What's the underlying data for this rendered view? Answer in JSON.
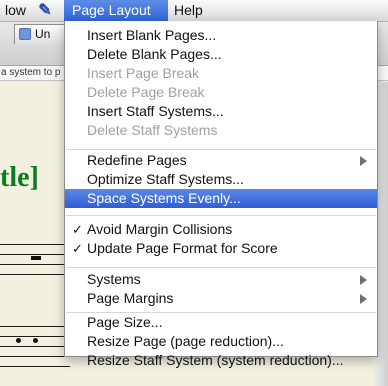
{
  "menubar": {
    "menus": [
      {
        "label": "low"
      },
      {
        "icon": "script-icon"
      },
      {
        "label": "Page Layout"
      },
      {
        "label": "Help"
      }
    ]
  },
  "background": {
    "document_tab": "Un",
    "hint_text": "a system to p",
    "page_title_fragment": "tle]"
  },
  "menu": {
    "items": [
      {
        "label": "Insert Blank Pages..."
      },
      {
        "label": "Delete Blank Pages..."
      },
      {
        "label": "Insert Page Break"
      },
      {
        "label": "Delete Page Break"
      },
      {
        "label": "Insert Staff Systems..."
      },
      {
        "label": "Delete Staff Systems"
      },
      {
        "label": "Redefine Pages"
      },
      {
        "label": "Optimize Staff Systems..."
      },
      {
        "label": "Space Systems Evenly..."
      },
      {
        "label": "Avoid Margin Collisions"
      },
      {
        "label": "Update Page Format for Score"
      },
      {
        "label": "Systems"
      },
      {
        "label": "Page Margins"
      },
      {
        "label": "Page Size..."
      },
      {
        "label": "Resize Page (page reduction)..."
      },
      {
        "label": "Resize Staff System (system reduction)..."
      }
    ],
    "checkmark": "✓",
    "disabled_items": [
      "Insert Page Break",
      "Delete Page Break",
      "Delete Staff Systems"
    ],
    "highlighted_item": "Space Systems Evenly...",
    "checked_items": [
      "Avoid Margin Collisions",
      "Update Page Format for Score"
    ],
    "submenu_items": [
      "Redefine Pages",
      "Systems",
      "Page Margins"
    ]
  },
  "colors": {
    "menu_highlight": "#2f63d6",
    "title_green": "#0a7d20"
  }
}
